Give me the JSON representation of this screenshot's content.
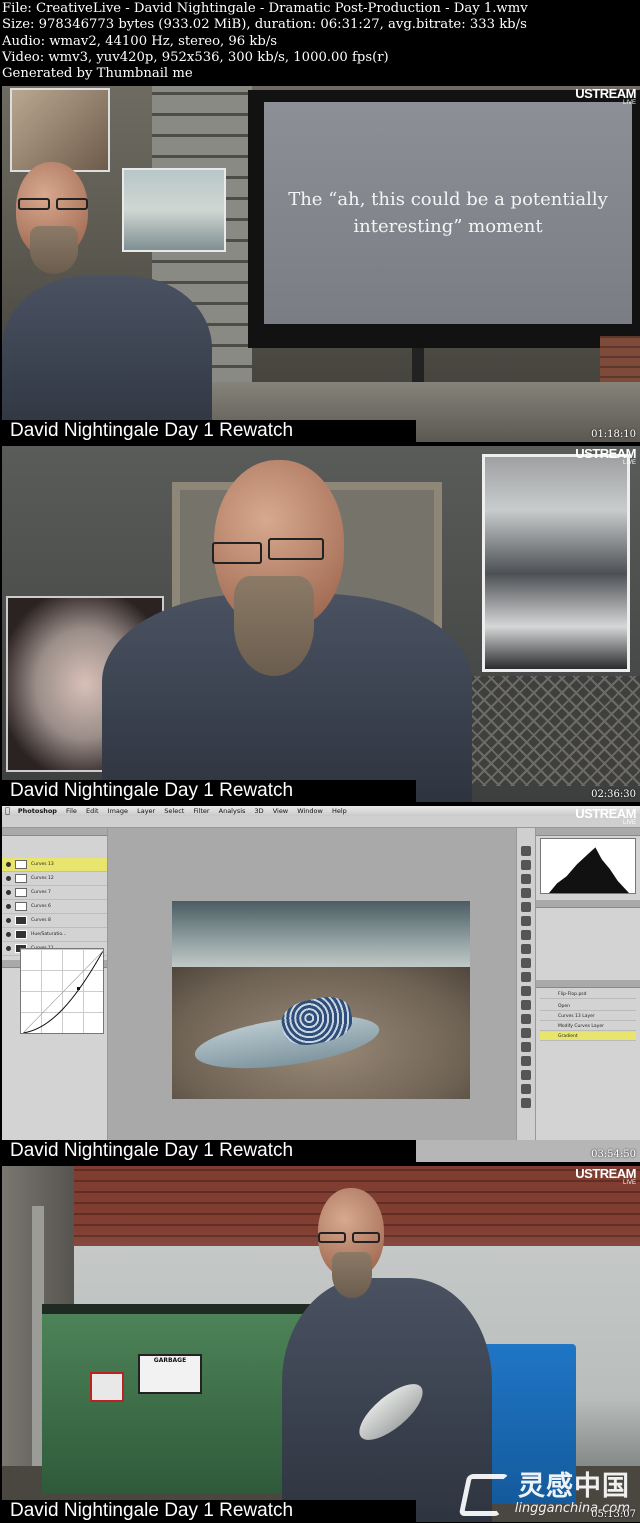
{
  "header": {
    "file_line": "File: CreativeLive - David Nightingale - Dramatic Post-Production - Day 1.wmv",
    "size_line": "Size: 978346773 bytes (933.02 MiB), duration: 06:31:27, avg.bitrate: 333 kb/s",
    "audio_line": "Audio: wmav2, 44100 Hz, stereo, 96 kb/s",
    "video_line": "Video: wmv3, yuv420p, 952x536, 300 kb/s, 1000.00 fps(r)",
    "generator_line": "Generated by Thumbnail me"
  },
  "frames": [
    {
      "caption": "David Nightingale Day 1 Rewatch",
      "timestamp": "01:18:10",
      "ustream": "USTREAM",
      "live": "LIVE",
      "screen_text": "The “ah, this could be a potentially interesting” moment"
    },
    {
      "caption": "David Nightingale Day 1 Rewatch",
      "timestamp": "02:36:30",
      "ustream": "USTREAM",
      "live": "LIVE"
    },
    {
      "caption": "David Nightingale Day 1 Rewatch",
      "timestamp": "03:54:50",
      "ustream": "USTREAM",
      "live": "LIVE",
      "photoshop": {
        "apple": "",
        "app_name": "Photoshop",
        "menus": [
          "File",
          "Edit",
          "Image",
          "Layer",
          "Select",
          "Filter",
          "Analysis",
          "3D",
          "View",
          "Window",
          "Help"
        ],
        "layers": [
          "Curves 13",
          "Curves 12",
          "Curves 7",
          "Curves 6",
          "Curves 8",
          "Hue/Saturatio...",
          "Curves 11"
        ],
        "history": [
          "Flip-Flop.psd",
          "Open",
          "Curves 13 Layer",
          "Modify Curves Layer",
          "Gradient"
        ]
      }
    },
    {
      "caption": "David Nightingale Day 1 Rewatch",
      "timestamp": "05:13:07",
      "ustream": "USTREAM",
      "live": "LIVE",
      "dumpster_label": "GARBAGE"
    }
  ],
  "watermark": {
    "chinese": "灵感中国",
    "site": "lingganchina.com"
  }
}
